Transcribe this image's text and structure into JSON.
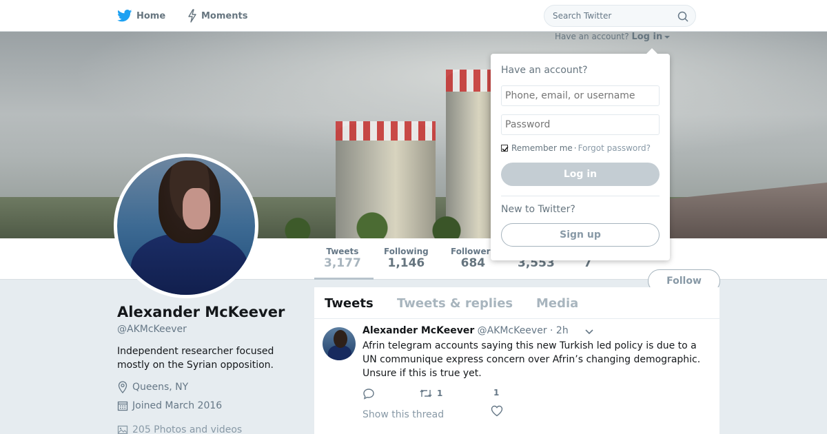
{
  "nav": {
    "home_label": "Home",
    "moments_label": "Moments",
    "search_placeholder": "Search Twitter"
  },
  "login_link": {
    "prompt": "Have an account?",
    "label": "Log in"
  },
  "login_dropdown": {
    "title": "Have an account?",
    "username_placeholder": "Phone, email, or username",
    "password_placeholder": "Password",
    "remember_label": "Remember me",
    "separator": "·",
    "forgot_label": "Forgot password?",
    "login_button": "Log in",
    "new_prompt": "New to Twitter?",
    "signup_button": "Sign up"
  },
  "stats": [
    {
      "label": "Tweets",
      "value": "3,177"
    },
    {
      "label": "Following",
      "value": "1,146"
    },
    {
      "label": "Followers",
      "value": "684"
    },
    {
      "label": "",
      "value": "3,553"
    },
    {
      "label": "",
      "value": "7"
    }
  ],
  "follow_button": "Follow",
  "profile": {
    "name": "Alexander McKeever",
    "handle": "@AKMcKeever",
    "bio": "Independent researcher focused mostly on the Syrian opposition.",
    "location": "Queens, NY",
    "joined": "Joined March 2016",
    "media": "205 Photos and videos"
  },
  "tabs": [
    "Tweets",
    "Tweets & replies",
    "Media"
  ],
  "tweet": {
    "name": "Alexander McKeever",
    "handle": "@AKMcKeever",
    "time": "· 2h",
    "text": "Afrin telegram accounts saying this new Turkish led policy is due to a UN communique express concern over Afrin’s changing demographic. Unsure if this is true yet.",
    "retweets": "1",
    "likes": "1",
    "thread_link": "Show this thread"
  },
  "colors": {
    "brand": "#1da1f2",
    "muted": "#657786",
    "background": "#e6ecf0"
  }
}
